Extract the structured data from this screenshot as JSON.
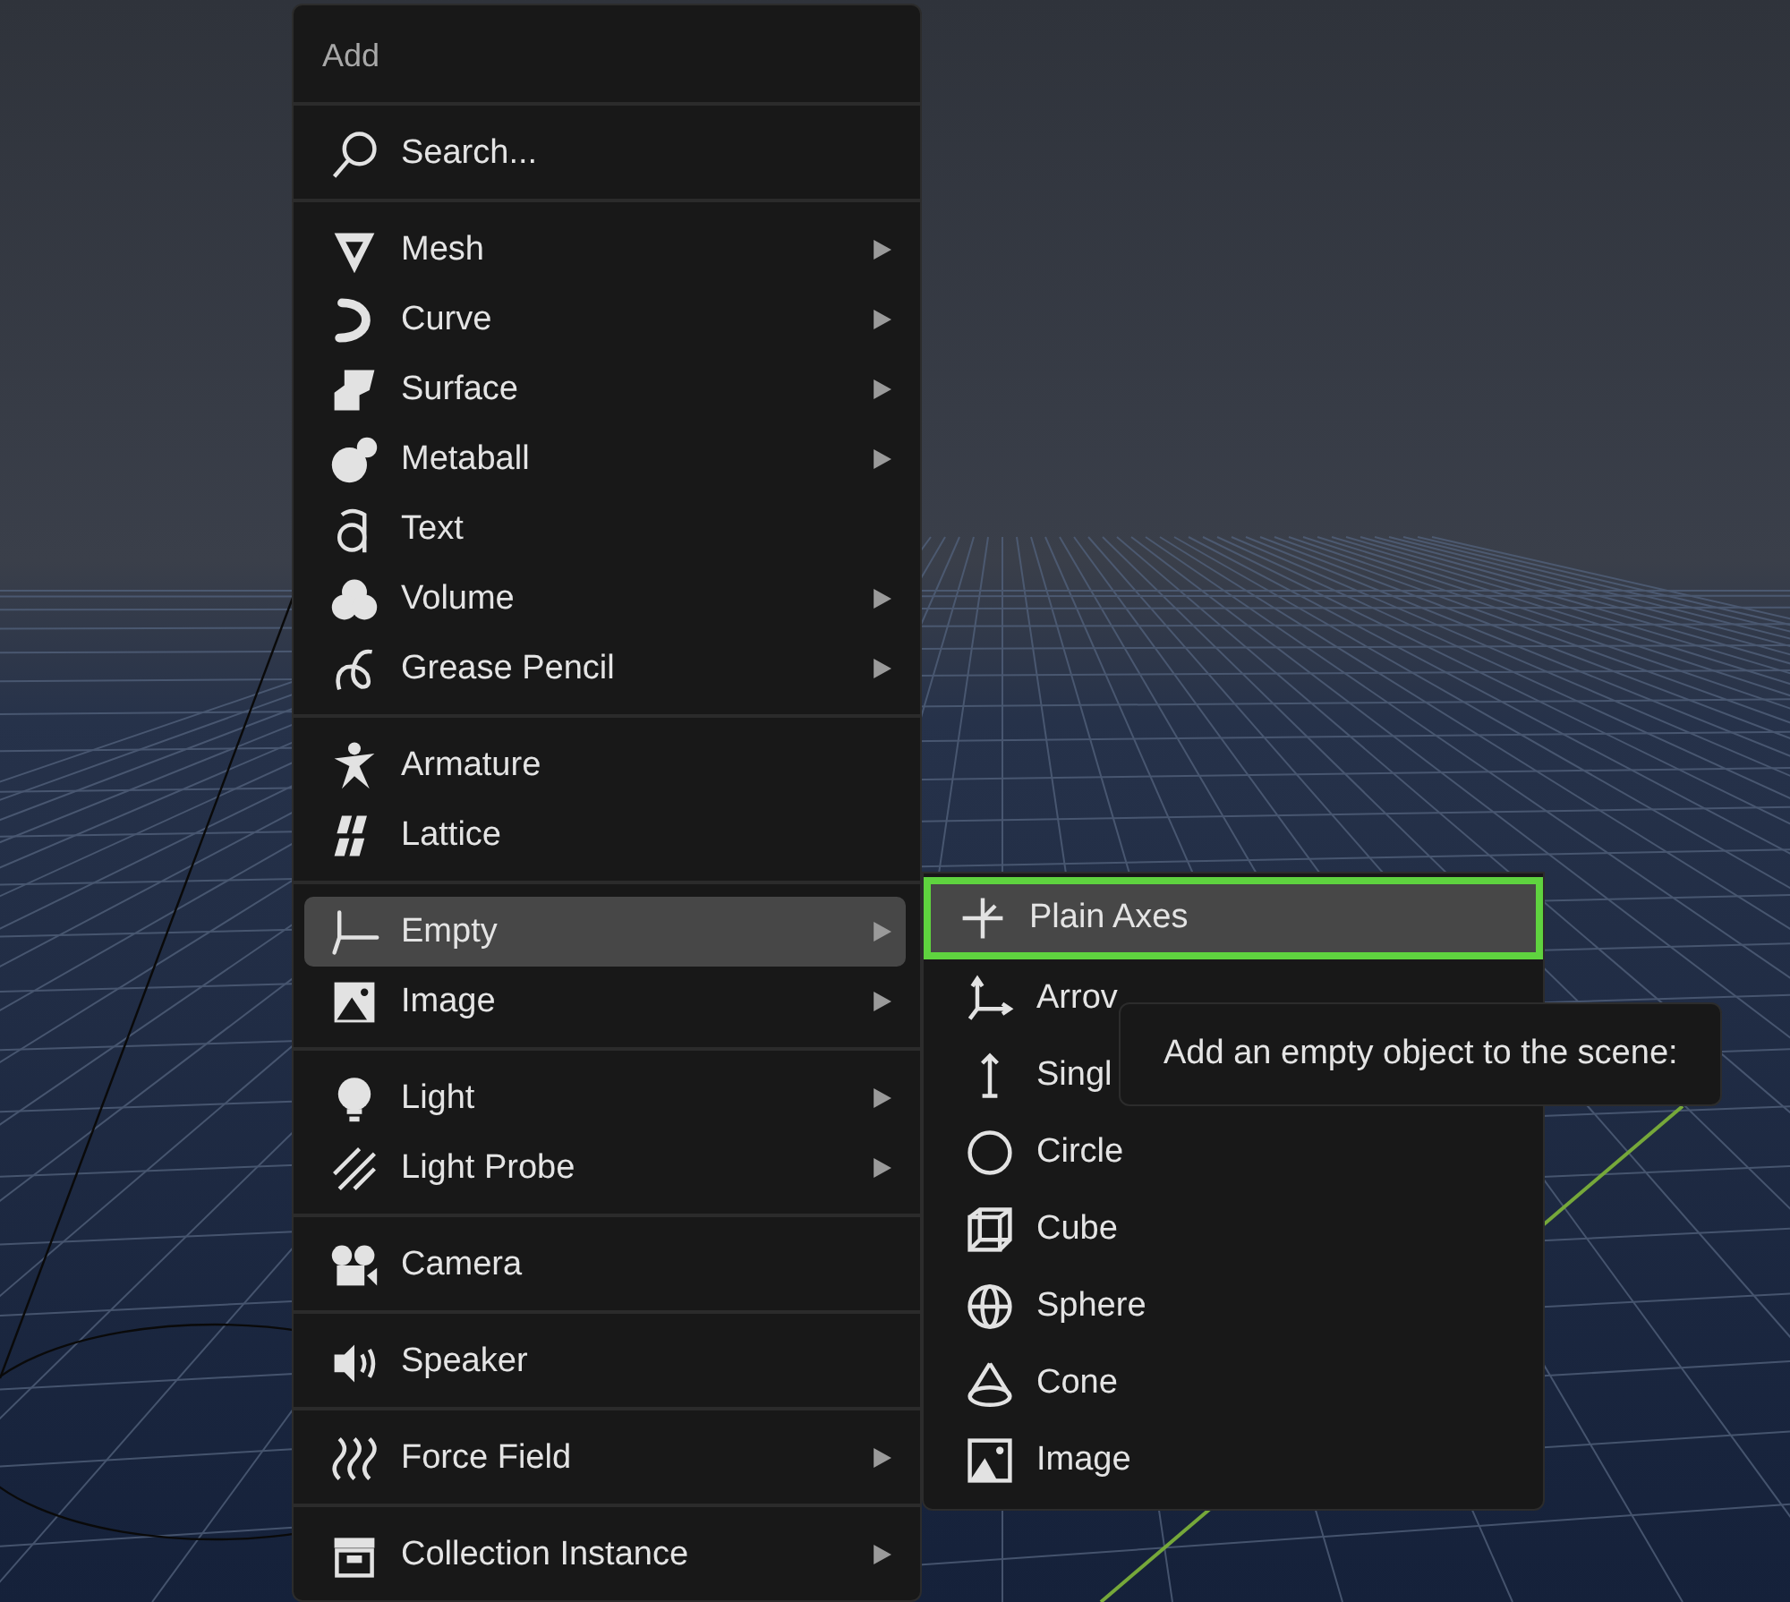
{
  "menu": {
    "title": "Add",
    "groups": [
      {
        "items": [
          {
            "label": "Search...",
            "submenu": false,
            "selected": false
          }
        ]
      },
      {
        "items": [
          {
            "label": "Mesh",
            "submenu": true,
            "selected": false
          },
          {
            "label": "Curve",
            "submenu": true,
            "selected": false
          },
          {
            "label": "Surface",
            "submenu": true,
            "selected": false
          },
          {
            "label": "Metaball",
            "submenu": true,
            "selected": false
          },
          {
            "label": "Text",
            "submenu": false,
            "selected": false
          },
          {
            "label": "Volume",
            "submenu": true,
            "selected": false
          },
          {
            "label": "Grease Pencil",
            "submenu": true,
            "selected": false
          }
        ]
      },
      {
        "items": [
          {
            "label": "Armature",
            "submenu": false,
            "selected": false
          },
          {
            "label": "Lattice",
            "submenu": false,
            "selected": false
          }
        ]
      },
      {
        "items": [
          {
            "label": "Empty",
            "submenu": true,
            "selected": true
          },
          {
            "label": "Image",
            "submenu": true,
            "selected": false
          }
        ]
      },
      {
        "items": [
          {
            "label": "Light",
            "submenu": true,
            "selected": false
          },
          {
            "label": "Light Probe",
            "submenu": true,
            "selected": false
          }
        ]
      },
      {
        "items": [
          {
            "label": "Camera",
            "submenu": false,
            "selected": false
          }
        ]
      },
      {
        "items": [
          {
            "label": "Speaker",
            "submenu": false,
            "selected": false
          }
        ]
      },
      {
        "items": [
          {
            "label": "Force Field",
            "submenu": true,
            "selected": false
          }
        ]
      },
      {
        "items": [
          {
            "label": "Collection Instance",
            "submenu": true,
            "selected": false
          }
        ]
      }
    ]
  },
  "submenu": {
    "items": [
      {
        "label": "Plain Axes",
        "selected": true,
        "outlined": true
      },
      {
        "label": "Arrov",
        "selected": false,
        "outlined": false
      },
      {
        "label": "Singl",
        "selected": false,
        "outlined": false
      },
      {
        "label": "Circle",
        "selected": false,
        "outlined": false
      },
      {
        "label": "Cube",
        "selected": false,
        "outlined": false
      },
      {
        "label": "Sphere",
        "selected": false,
        "outlined": false
      },
      {
        "label": "Cone",
        "selected": false,
        "outlined": false
      },
      {
        "label": "Image",
        "selected": false,
        "outlined": false
      }
    ]
  },
  "tooltip": {
    "text": "Add an empty object to the scene:"
  }
}
